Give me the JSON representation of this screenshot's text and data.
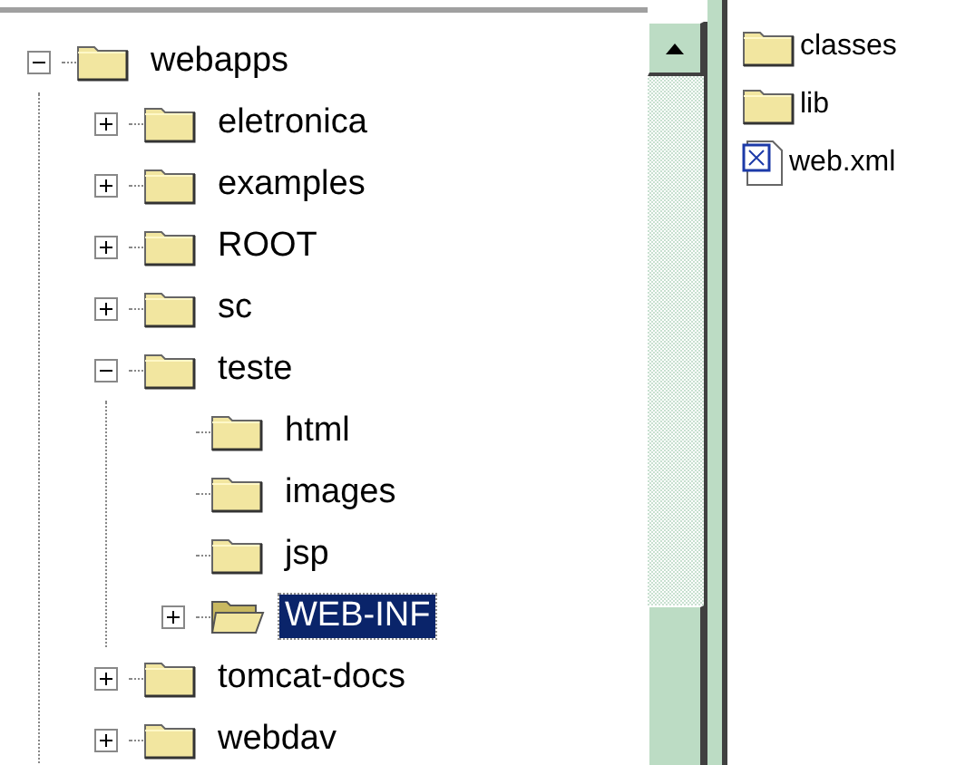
{
  "tree": [
    {
      "label": "webapps",
      "kind": "folder",
      "expanded": true,
      "selected": false,
      "children": [
        {
          "label": "eletronica",
          "kind": "folder",
          "expanded": false,
          "selected": false
        },
        {
          "label": "examples",
          "kind": "folder",
          "expanded": false,
          "selected": false
        },
        {
          "label": "ROOT",
          "kind": "folder",
          "expanded": false,
          "selected": false
        },
        {
          "label": "sc",
          "kind": "folder",
          "expanded": false,
          "selected": false
        },
        {
          "label": "teste",
          "kind": "folder",
          "expanded": true,
          "selected": false,
          "children": [
            {
              "label": "html",
              "kind": "leaf-folder",
              "selected": false
            },
            {
              "label": "images",
              "kind": "leaf-folder",
              "selected": false
            },
            {
              "label": "jsp",
              "kind": "leaf-folder",
              "selected": false
            },
            {
              "label": "WEB-INF",
              "kind": "folder",
              "expanded": false,
              "selected": true
            }
          ]
        },
        {
          "label": "tomcat-docs",
          "kind": "folder",
          "expanded": false,
          "selected": false
        },
        {
          "label": "webdav",
          "kind": "folder",
          "expanded": false,
          "selected": false
        }
      ]
    }
  ],
  "files": [
    {
      "name": "classes",
      "kind": "folder"
    },
    {
      "name": "lib",
      "kind": "folder"
    },
    {
      "name": "web.xml",
      "kind": "xml"
    }
  ]
}
